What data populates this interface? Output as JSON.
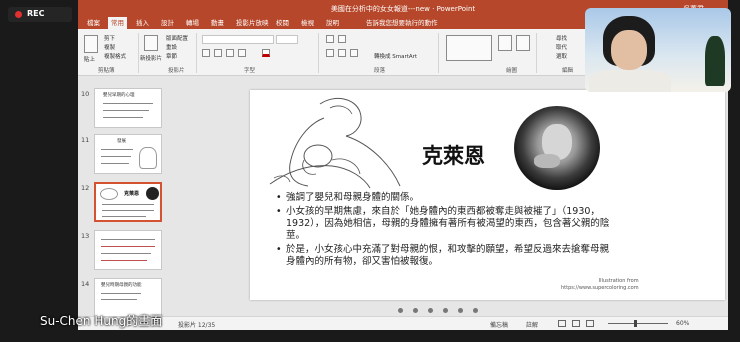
{
  "recording": {
    "label": "REC"
  },
  "window": {
    "title": "美國在分析中的女女報道---new · PowerPoint",
    "user": "吳蕙君"
  },
  "ribbon_tabs": [
    {
      "label": "檔案"
    },
    {
      "label": "常用"
    },
    {
      "label": "插入"
    },
    {
      "label": "設計"
    },
    {
      "label": "轉場"
    },
    {
      "label": "動畫"
    },
    {
      "label": "投影片放映"
    },
    {
      "label": "校閱"
    },
    {
      "label": "檢視"
    },
    {
      "label": "說明"
    },
    {
      "label": "告訴我您想要執行的動作"
    }
  ],
  "ribbon": {
    "clipboard": {
      "label": "剪貼簿",
      "paste": "貼上",
      "cut": "剪下",
      "copy": "複製",
      "format_painter": "複製格式"
    },
    "slides": {
      "label": "投影片",
      "new_slide": "新投影片",
      "layout": "版面配置",
      "reset": "重設",
      "section": "章節"
    },
    "font": {
      "label": "字型"
    },
    "paragraph": {
      "label": "段落",
      "convert": "轉換成 SmartArt"
    },
    "drawing": {
      "label": "繪圖"
    },
    "editing": {
      "label": "編輯",
      "find": "尋找",
      "replace": "取代",
      "select": "選取"
    }
  },
  "thumbnails": [
    {
      "number": "10",
      "title": "嬰兒早期的心理"
    },
    {
      "number": "11",
      "title": "發展"
    },
    {
      "number": "12",
      "title": "克萊恩"
    },
    {
      "number": "13",
      "title": ""
    },
    {
      "number": "14",
      "title": "嬰兒時期母親的功能"
    }
  ],
  "slide": {
    "title": "克萊恩",
    "bullets": [
      "強調了嬰兒和母親身體的關係。",
      "小女孩的早期焦慮，來自於「她身體內的東西都被奪走與被摧了」（1930，1932），因為她相信，母親的身體擁有著所有被渴望的東西，包含著父親的陰莖。",
      "於是，小女孩心中充滿了對母親的恨，和攻擊的願望，希望反過來去搶奪母親身體內的所有物，卻又害怕被報復。"
    ],
    "caption_line1": "Illustration from",
    "caption_line2": "https://www.supercoloring.com"
  },
  "status": {
    "slide_counter": "投影片 12/35",
    "notes": "備忘稿",
    "comments": "註解",
    "zoom": "60%"
  },
  "participant": {
    "name": "Su-Chen Hung的畫面"
  },
  "colors": {
    "ppt_accent": "#b7472a",
    "rec_dot": "#e03030"
  }
}
